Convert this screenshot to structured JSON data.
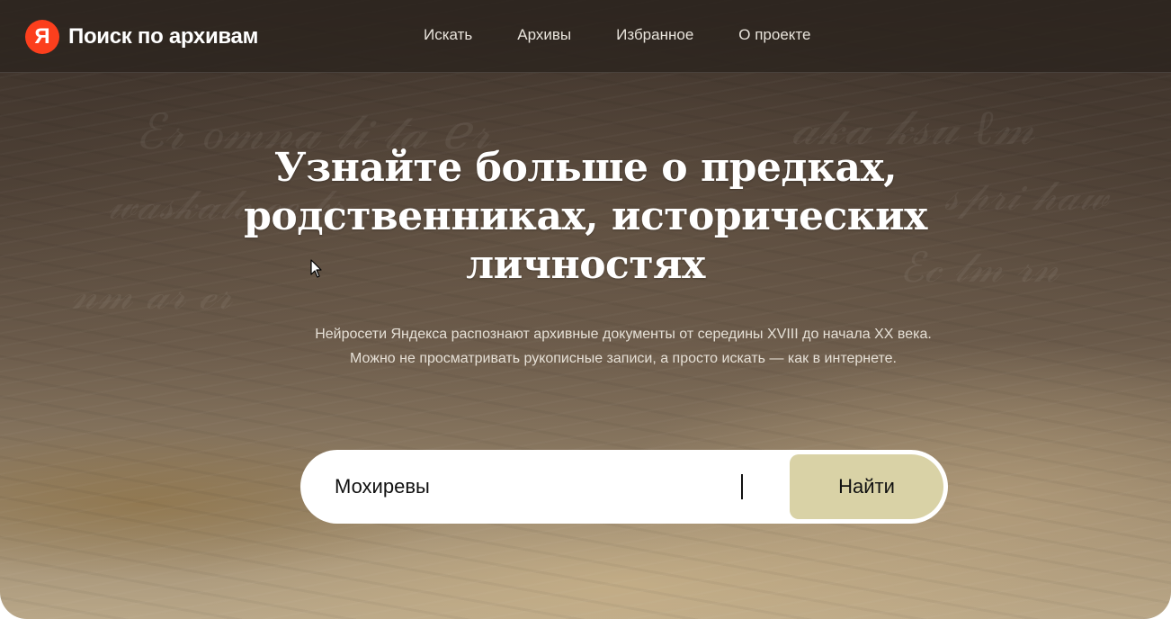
{
  "header": {
    "logo_letter": "Я",
    "logo_text": "Поиск по архивам",
    "nav": [
      {
        "label": "Искать"
      },
      {
        "label": "Архивы"
      },
      {
        "label": "Избранное"
      },
      {
        "label": "О проекте"
      }
    ]
  },
  "hero": {
    "title_lines": [
      "Узнайте больше о предках,",
      "родственниках, исторических",
      "личностях"
    ],
    "subtitle_lines": [
      "Нейросети Яндекса распознают архивные документы от середины XVIII до начала XX века.",
      "Можно не просматривать рукописные записи, а просто искать — как в интернете."
    ]
  },
  "search": {
    "value": "Мохиревы",
    "button_label": "Найти"
  },
  "colors": {
    "logo_accent": "#fc3f1d",
    "button_bg": "#d9d2a6",
    "topbar_bg": "#2c241e"
  },
  "icons": {
    "logo": "yandex-logo-icon",
    "pointer": "mouse-pointer-icon"
  }
}
